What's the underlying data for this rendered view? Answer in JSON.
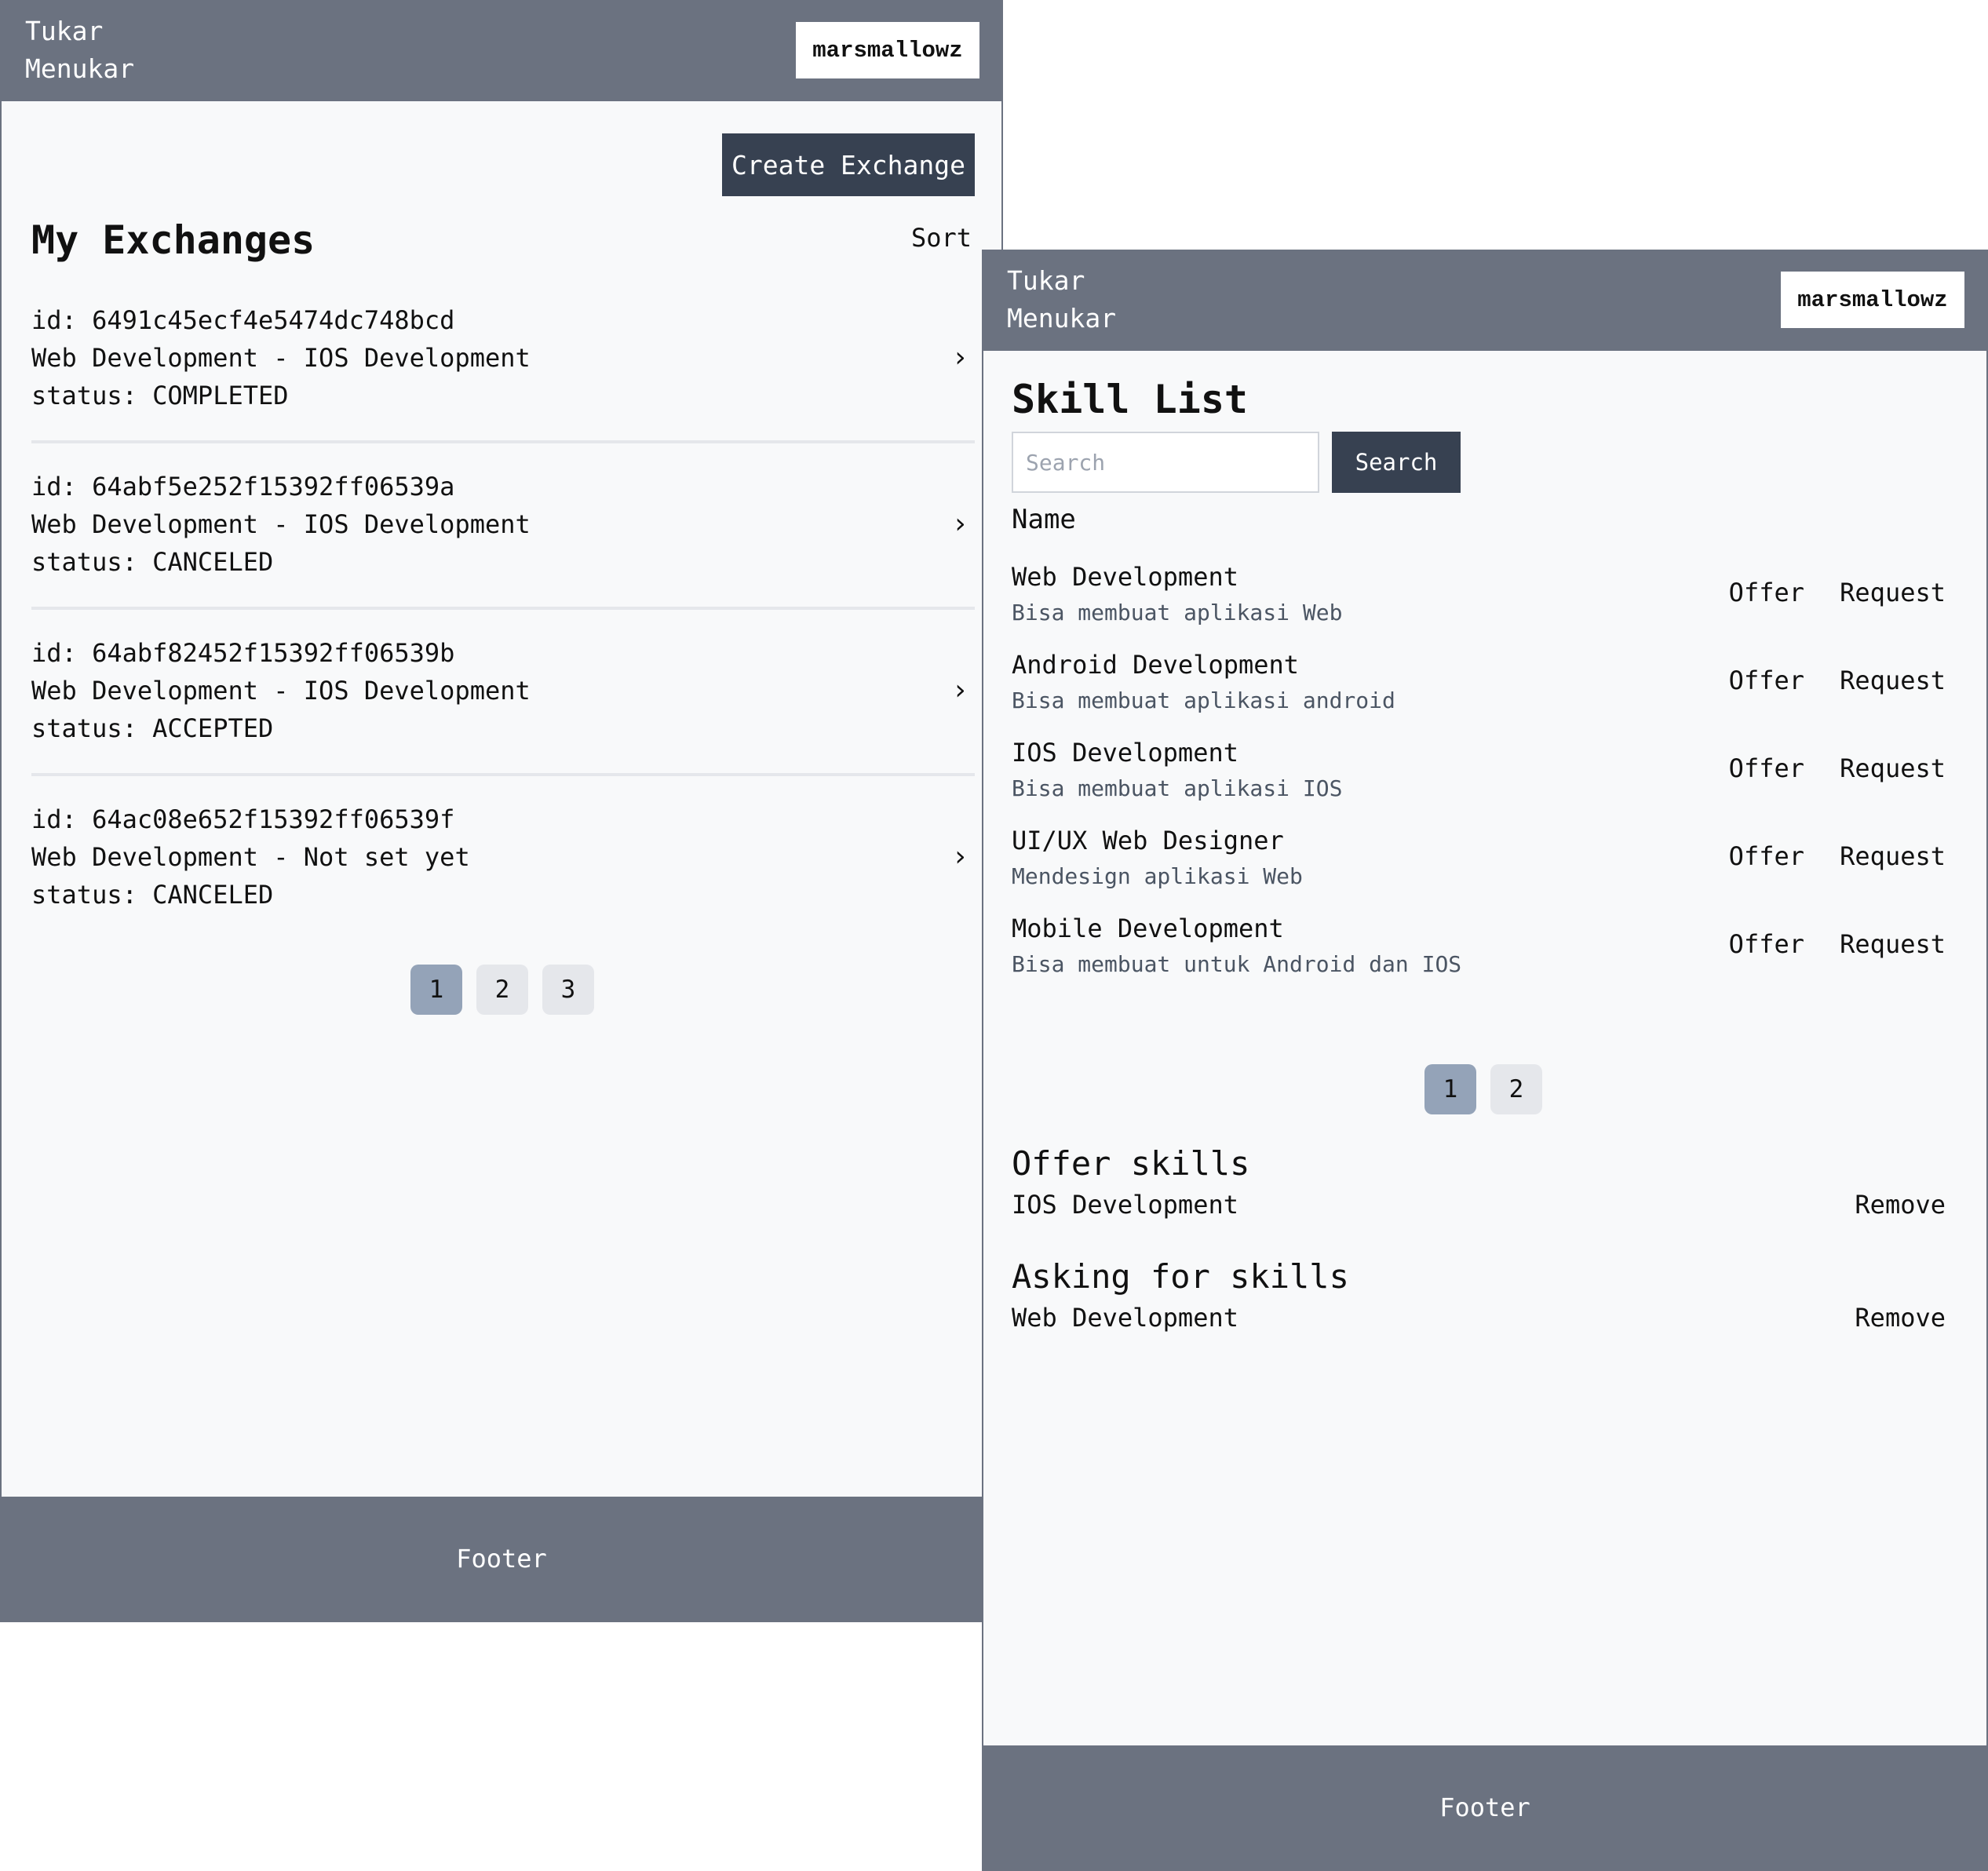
{
  "window_a": {
    "brand_line1": "Tukar",
    "brand_line2": "Menukar",
    "username": "marsmallowz",
    "create_label": "Create Exchange",
    "title": "My Exchanges",
    "sort_label": "Sort",
    "exchanges": [
      {
        "id": "id: 6491c45ecf4e5474dc748bcd",
        "skills": "Web Development - IOS Development",
        "status": "status: COMPLETED"
      },
      {
        "id": "id: 64abf5e252f15392ff06539a",
        "skills": "Web Development - IOS Development",
        "status": "status: CANCELED"
      },
      {
        "id": "id: 64abf82452f15392ff06539b",
        "skills": "Web Development - IOS Development",
        "status": "status: ACCEPTED"
      },
      {
        "id": "id: 64ac08e652f15392ff06539f",
        "skills": "Web Development - Not set yet",
        "status": "status: CANCELED"
      }
    ],
    "pages": [
      "1",
      "2",
      "3"
    ],
    "active_page": "1",
    "footer": "Footer"
  },
  "window_b": {
    "brand_line1": "Tukar",
    "brand_line2": "Menukar",
    "username": "marsmallowz",
    "title": "Skill List",
    "search_placeholder": "Search",
    "search_label": "Search",
    "column_header": "Name",
    "offer_label": "Offer",
    "request_label": "Request",
    "skills": [
      {
        "name": "Web Development",
        "desc": "Bisa membuat aplikasi Web"
      },
      {
        "name": "Android Development",
        "desc": "Bisa membuat aplikasi android"
      },
      {
        "name": "IOS Development",
        "desc": "Bisa membuat aplikasi IOS"
      },
      {
        "name": "UI/UX Web Designer",
        "desc": "Mendesign aplikasi Web"
      },
      {
        "name": "Mobile Development",
        "desc": "Bisa membuat untuk Android dan IOS"
      }
    ],
    "pages": [
      "1",
      "2"
    ],
    "active_page": "1",
    "offer_title": "Offer skills",
    "offer_items": [
      "IOS Development"
    ],
    "asking_title": "Asking for skills",
    "asking_items": [
      "Web Development"
    ],
    "remove_label": "Remove",
    "footer": "Footer"
  },
  "icons": {
    "chevron": "chevron-right-icon"
  },
  "colors": {
    "header": "#6b7280",
    "button_dark": "#374151",
    "page_active": "#94a3b8",
    "page_inactive": "#e5e7eb"
  }
}
